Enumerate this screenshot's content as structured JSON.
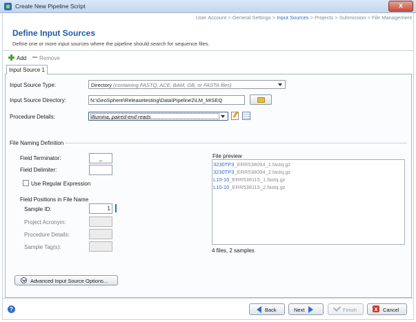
{
  "window": {
    "title": "Create New Pipeline Script",
    "close_glyph": "x"
  },
  "breadcrumb": {
    "before": "User Account > General Settings > ",
    "current": "Input Sources",
    "after": " > Projects > Submission > File Management"
  },
  "header": {
    "title": "Define Input Sources",
    "subtitle": "Define one or more input sources where the pipeline should search for sequence files."
  },
  "toolbar": {
    "add_label": "Add",
    "remove_label": "Remove"
  },
  "tabs": [
    {
      "label": "Input Source 1",
      "selected": true
    }
  ],
  "source": {
    "type_label": "Input Source Type:",
    "type_value": "Directory",
    "type_hint": "(containing FASTQ, ACE, BAM, GB, or FASTA files)",
    "directory_label": "Input Source Directory:",
    "directory_value": "N:\\GeoSphere\\Releasetesting\\Data\\Pipeline2\\LM_MISEQ",
    "procedure_label": "Procedure Details:",
    "procedure_value": "Illumina, paired-end reads"
  },
  "naming": {
    "section_label": "File Naming Definition",
    "field_terminator_label": "Field Terminator:",
    "field_terminator_value": "_",
    "field_delimiter_label": "Field Delimiter:",
    "field_delimiter_value": "",
    "regex_label": "Use Regular Expression",
    "regex_checked": false,
    "positions_label": "Field Positions in File Name",
    "sample_id_label": "Sample ID:",
    "sample_id_value": "1",
    "project_acronym_label": "Project Acronym:",
    "procedure_details_label": "Procedure Details:",
    "sample_tags_label": "Sample Tag(s):"
  },
  "preview": {
    "label": "File preview",
    "files": [
      {
        "match": "3230TP3",
        "rest": "_ERR538094_1.fastq.gz"
      },
      {
        "match": "3230TP3",
        "rest": "_ERR538094_2.fastq.gz"
      },
      {
        "match": "L10-10",
        "rest": "_ERR538115_1.fastq.gz"
      },
      {
        "match": "L10-10",
        "rest": "_ERR538115_2.fastq.gz"
      }
    ],
    "summary": "4 files, 2 samples"
  },
  "advanced_button_label": "Advanced Input Source Options...",
  "footer": {
    "help_glyph": "?",
    "back_label": "Back",
    "next_label": "Next",
    "finish_label": "Finish",
    "cancel_label": "Cancel",
    "cancel_glyph": "x"
  },
  "icons": [
    "app-icon",
    "close-icon",
    "plus-icon",
    "minus-icon",
    "folder-icon",
    "edit-icon",
    "table-icon",
    "expand-icon",
    "help-icon",
    "back-arrow-icon",
    "next-arrow-icon",
    "check-icon",
    "cancel-icon"
  ],
  "colors": {
    "title_blue": "#1f5ba6",
    "breadcrumb_current": "#2a6fc2",
    "match_blue": "#2b66c4"
  }
}
